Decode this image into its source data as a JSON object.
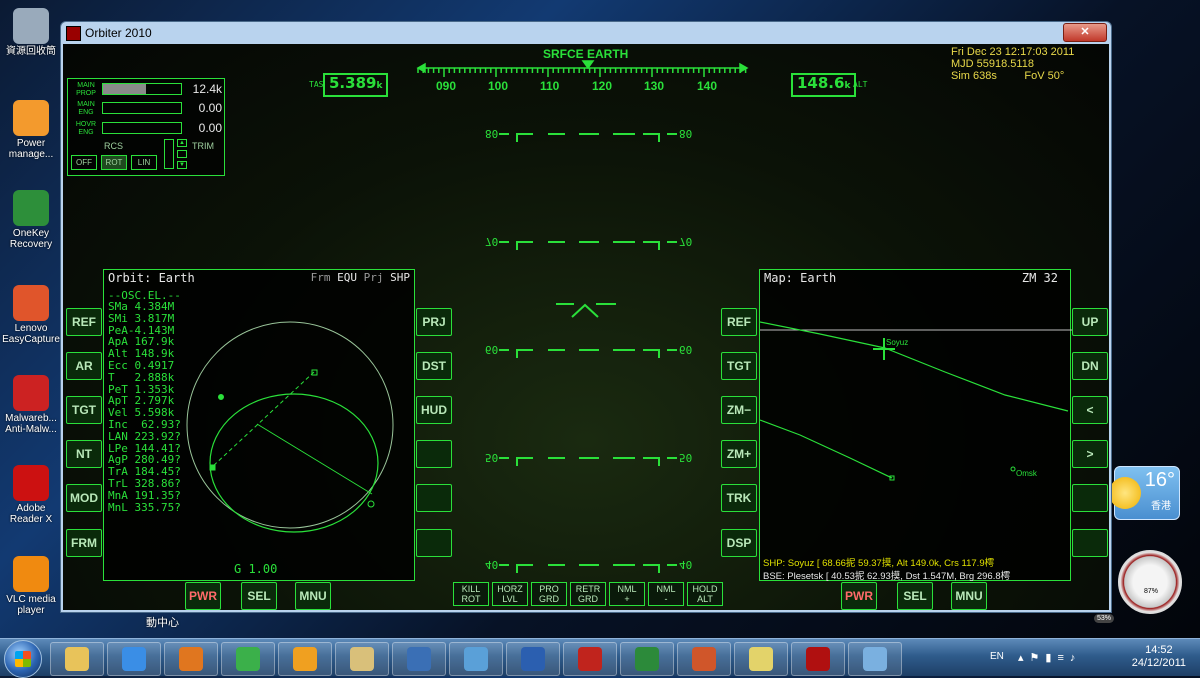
{
  "desktop": {
    "icons": [
      {
        "label": "資源回收筒",
        "color": "#9ab"
      },
      {
        "label": "Power manage...",
        "color": "#f39a2d"
      },
      {
        "label": "OneKey Recovery",
        "color": "#2d8f3a"
      },
      {
        "label": "Lenovo EasyCapture",
        "color": "#e0552b"
      },
      {
        "label": "Malwareb... Anti-Malw...",
        "color": "#c22"
      },
      {
        "label": "Adobe Reader X",
        "color": "#c11"
      },
      {
        "label": "VLC media player",
        "color": "#f08a10"
      }
    ],
    "partial_label": "動中心",
    "weather": {
      "temp": "16°",
      "city": "香港"
    },
    "gauge": {
      "pct1": "87%",
      "pct2": "53%"
    }
  },
  "window": {
    "title": "Orbiter 2010",
    "close_label": "✕"
  },
  "hud": {
    "mode": "SRFCE EARTH",
    "tas_label": "TAS",
    "tas_value": "5.389",
    "tas_unit": "k",
    "alt_value": "148.6",
    "alt_unit": "k",
    "alt_label": "ALT",
    "heading_ticks": [
      "090",
      "100",
      "110",
      "120",
      "130",
      "140"
    ],
    "pitch_ladder": [
      "80",
      "70",
      "60",
      "50",
      "40"
    ]
  },
  "info": {
    "date": "Fri Dec 23 12:17:03 2011",
    "mjd": "MJD 55918.5118",
    "sim": "Sim  638s",
    "fov": "FoV  50°"
  },
  "engine": {
    "main_prop_label": "MAIN PROP",
    "main_prop_value": "12.4k",
    "main_prop_level": 0.55,
    "main_eng_label": "MAIN ENG",
    "main_eng_value": "0.00",
    "hovr_eng_label": "HOVR ENG",
    "hovr_eng_value": "0.00",
    "rcs_label": "RCS",
    "trim_label": "TRIM",
    "rcs_modes": [
      "OFF",
      "ROT",
      "LIN"
    ]
  },
  "left_mfd": {
    "title": "Orbit: Earth",
    "frm_label": "Frm",
    "frm_value": "EQU",
    "prj_label": "Prj",
    "prj_value": "SHP",
    "header": "--OSC.EL.--",
    "elements": [
      "SMa 4.384M",
      "SMi 3.817M",
      "PeA-4.143M",
      "ApA 167.9k",
      "Alt 148.9k",
      "Ecc 0.4917",
      "T   2.888k",
      "PeT 1.353k",
      "ApT 2.797k",
      "Vel 5.598k",
      "Inc  62.93?",
      "LAN 223.92?",
      "LPe 144.41?",
      "AgP 280.49?",
      "TrA 184.45?",
      "TrL 328.86?",
      "MnA 191.35?",
      "MnL 335.75?"
    ],
    "g_readout": "G 1.00",
    "left_buttons": [
      "REF",
      "AR",
      "TGT",
      "NT",
      "MOD",
      "FRM"
    ],
    "right_buttons": [
      "PRJ",
      "DST",
      "HUD",
      "",
      "",
      ""
    ],
    "bottom_buttons": [
      "PWR",
      "SEL",
      "MNU"
    ]
  },
  "right_mfd": {
    "title": "Map: Earth",
    "zoom": "ZM 32",
    "vessel": "Soyuz",
    "base": "Omsk",
    "shp_line": "SHP:  Soyuz [ 68.66抳  59.37摸, Alt  149.0k, Crs 117.9樗",
    "bse_line": "BSE:  Plesetsk [ 40.53抳  62.93摸, Dst 1.547M, Brg 296.8樗",
    "left_buttons": [
      "REF",
      "TGT",
      "ZM−",
      "ZM+",
      "TRK",
      "DSP"
    ],
    "right_buttons": [
      "UP",
      "DN",
      "<",
      ">",
      "",
      ""
    ],
    "bottom_buttons": [
      "PWR",
      "SEL",
      "MNU"
    ]
  },
  "hud_buttons": [
    {
      "l1": "KILL",
      "l2": "ROT"
    },
    {
      "l1": "HORZ",
      "l2": "LVL"
    },
    {
      "l1": "PRO",
      "l2": "GRD"
    },
    {
      "l1": "RETR",
      "l2": "GRD"
    },
    {
      "l1": "NML",
      "l2": "+"
    },
    {
      "l1": "NML",
      "l2": "-"
    },
    {
      "l1": "HOLD",
      "l2": "ALT"
    }
  ],
  "taskbar": {
    "lang": "EN",
    "time": "14:52",
    "date": "24/12/2011",
    "apps": [
      {
        "name": "explorer",
        "color": "#e8c35a"
      },
      {
        "name": "ie",
        "color": "#3a8ee6"
      },
      {
        "name": "firefox",
        "color": "#e0761f"
      },
      {
        "name": "chrome",
        "color": "#3bb04a"
      },
      {
        "name": "media",
        "color": "#f0a020"
      },
      {
        "name": "folder",
        "color": "#d9c07a"
      },
      {
        "name": "thunderbird",
        "color": "#3a6fb5"
      },
      {
        "name": "messenger",
        "color": "#5aa0d8"
      },
      {
        "name": "word",
        "color": "#2b5fb0"
      },
      {
        "name": "acrobat",
        "color": "#c0241d"
      },
      {
        "name": "excel",
        "color": "#2c8a3a"
      },
      {
        "name": "powerpoint",
        "color": "#d0562a"
      },
      {
        "name": "notes",
        "color": "#e3d36a"
      },
      {
        "name": "orbiter",
        "color": "#b01010"
      },
      {
        "name": "paint",
        "color": "#7ab0e0"
      }
    ]
  }
}
